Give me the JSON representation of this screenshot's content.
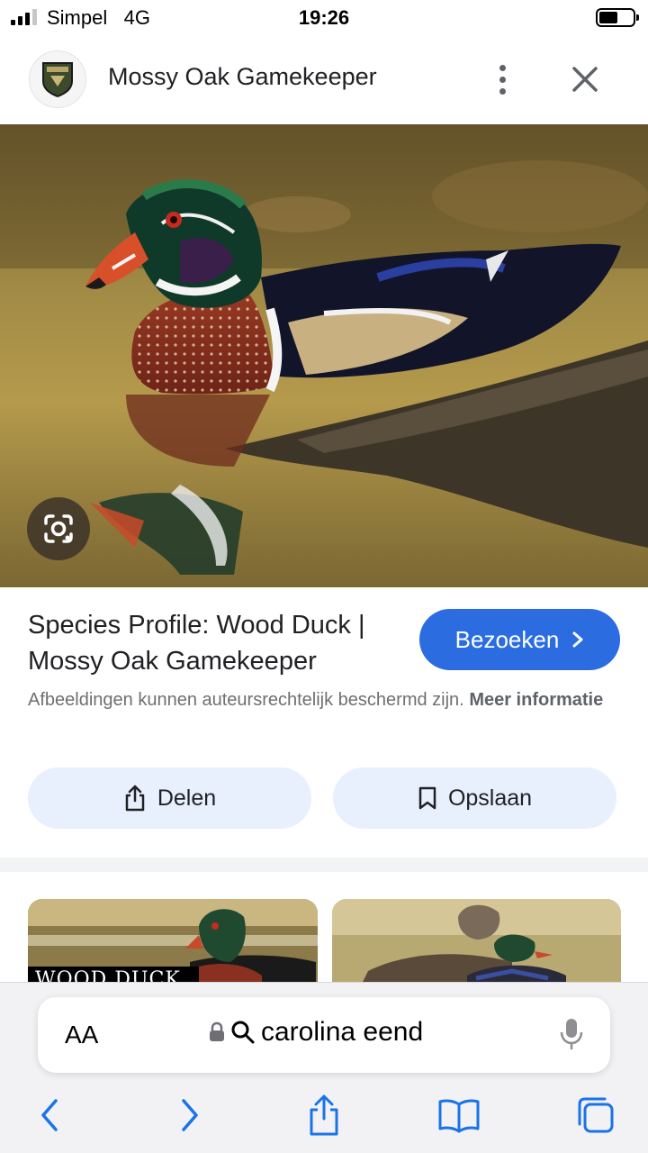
{
  "status": {
    "carrier": "Simpel",
    "network": "4G",
    "time": "19:26"
  },
  "header": {
    "site_name": "Mossy Oak Gamekeeper"
  },
  "result": {
    "title": "Species Profile: Wood Duck | Mossy Oak Gamekeeper",
    "visit_label": "Bezoeken",
    "copyright_text": "Afbeeldingen kunnen auteursrechtelijk beschermd zijn.",
    "more_info": "Meer informatie"
  },
  "actions": {
    "share_label": "Delen",
    "save_label": "Opslaan"
  },
  "related": {
    "thumb_a_text": "WOOD DUCK"
  },
  "browser": {
    "aa_label": "AA",
    "url_text": "carolina eend"
  },
  "colors": {
    "accent": "#2b6de0",
    "pill_bg": "#e8f0fe",
    "ios_blue": "#1a73e8"
  }
}
